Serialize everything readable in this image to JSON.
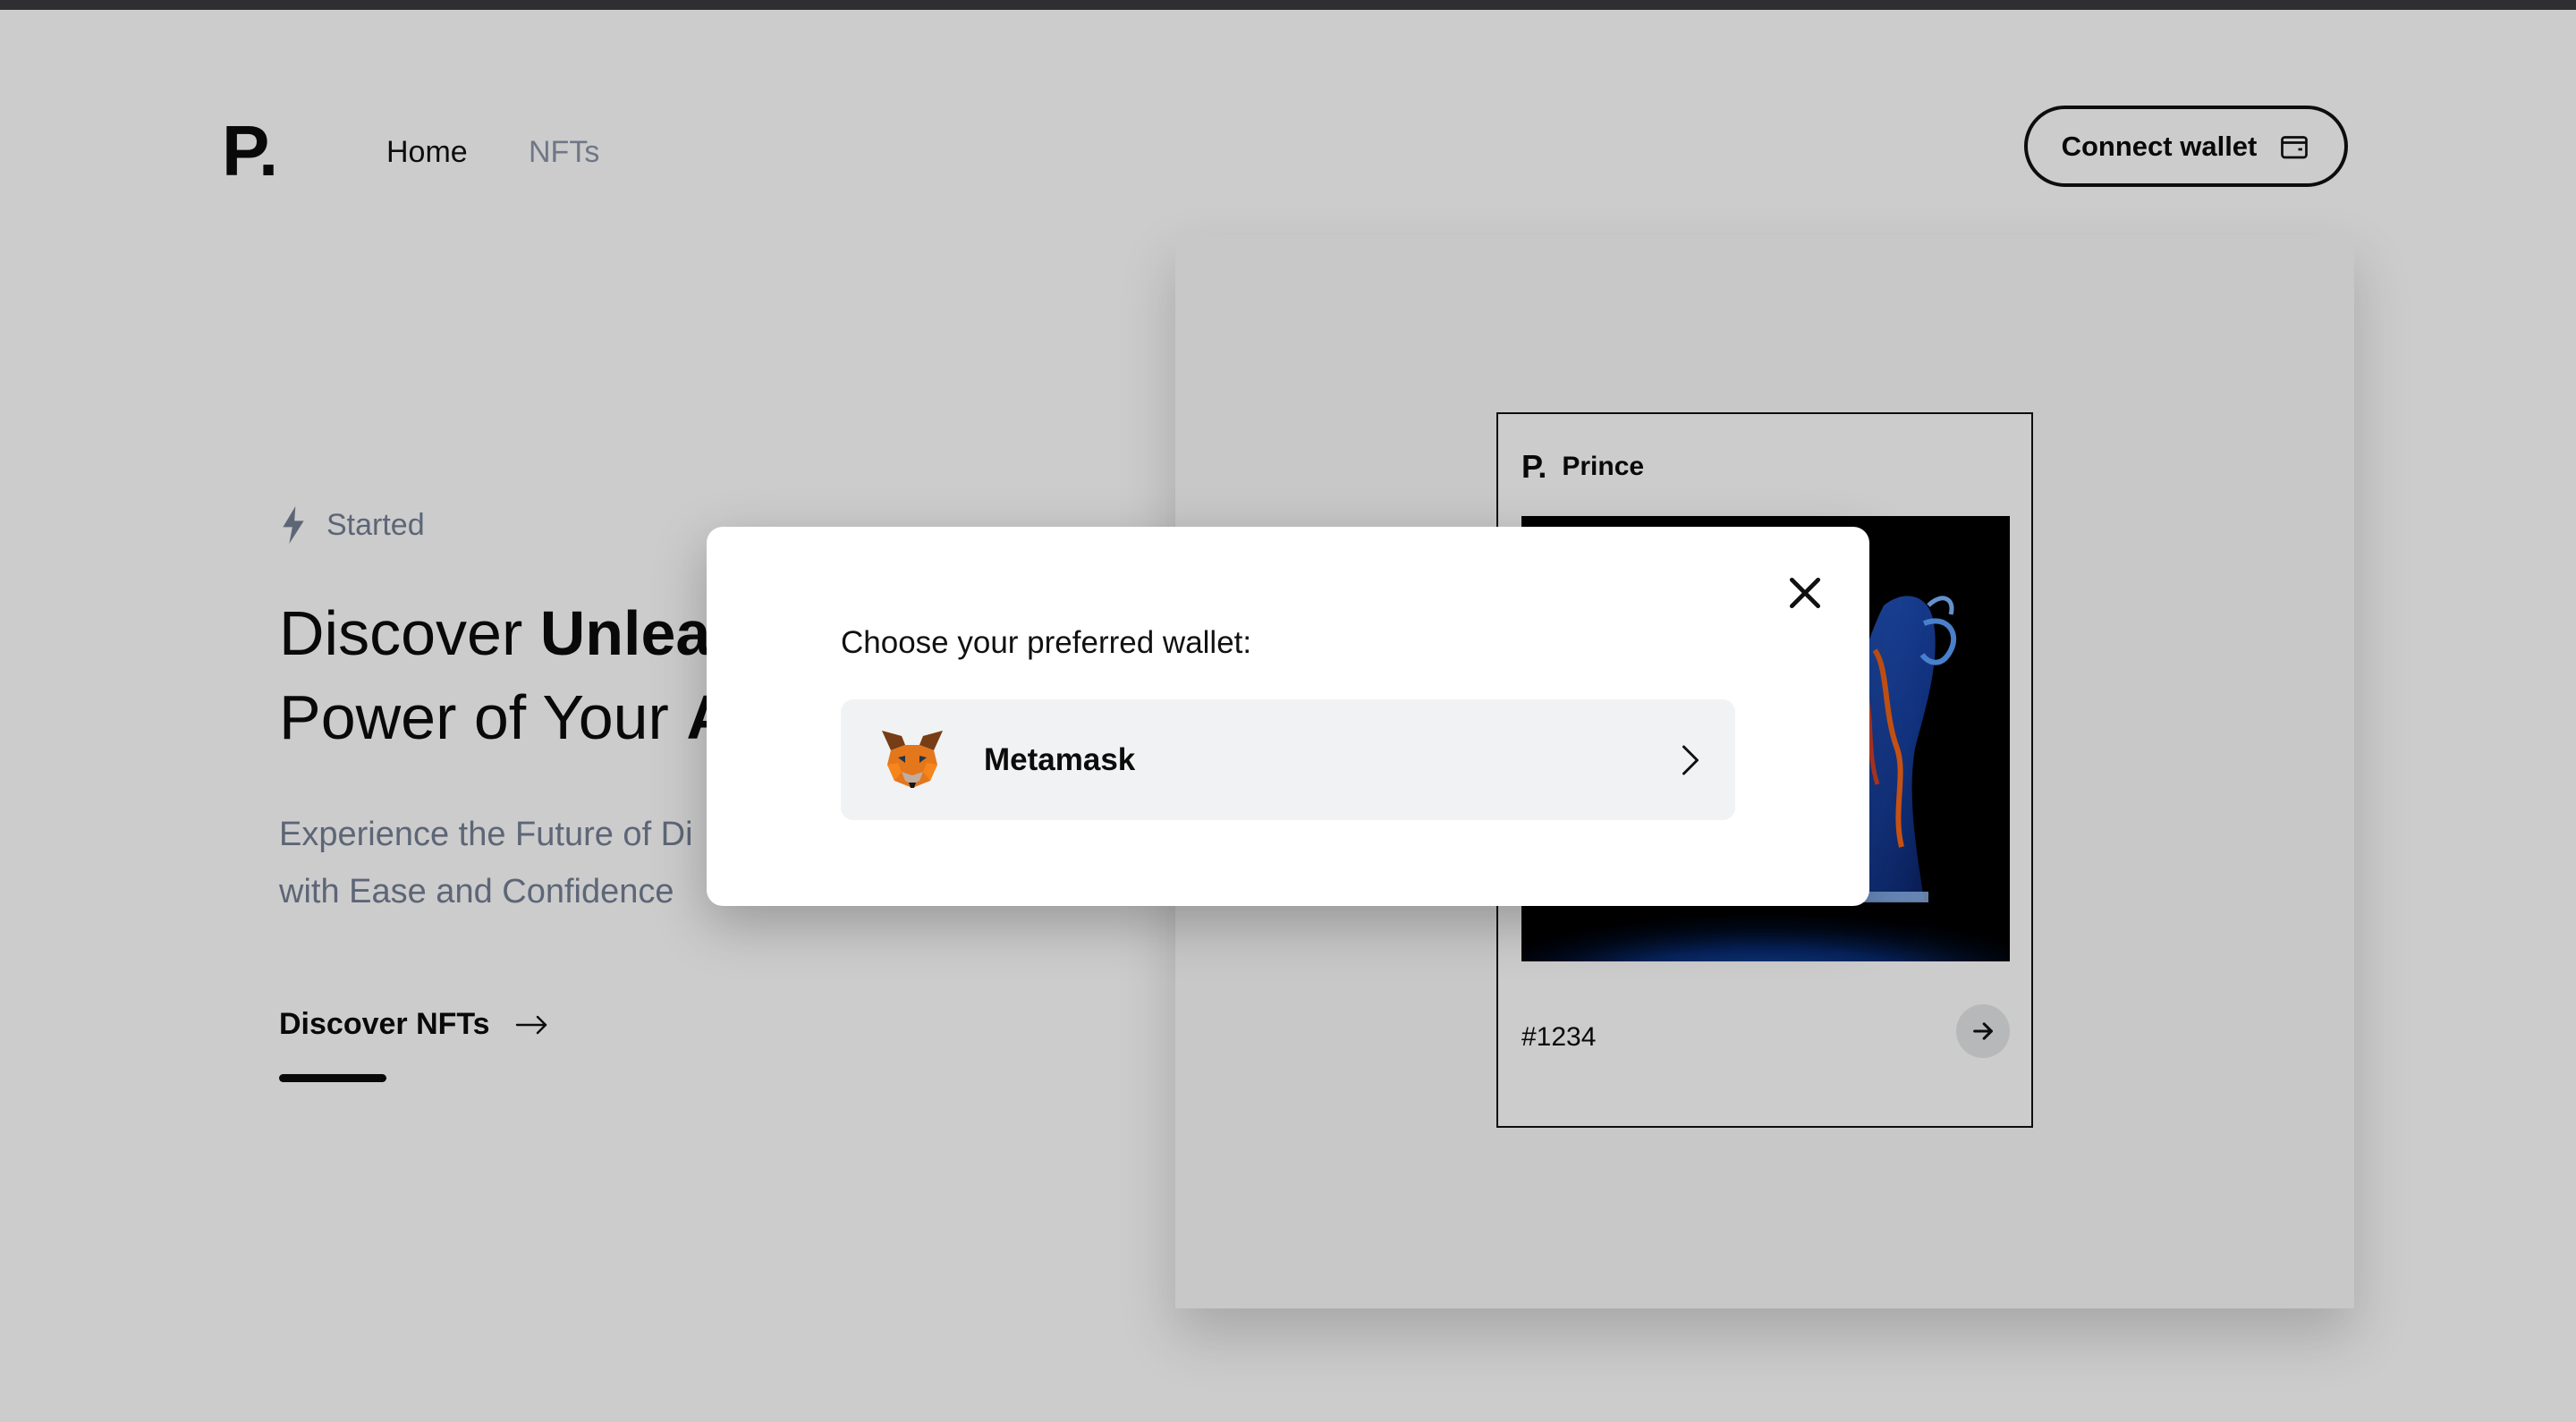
{
  "header": {
    "logo": "P.",
    "nav": [
      {
        "label": "Home",
        "active": true
      },
      {
        "label": "NFTs",
        "active": false
      }
    ],
    "connect_button": {
      "label": "Connect wallet",
      "icon": "wallet-icon"
    }
  },
  "hero": {
    "badge": {
      "icon": "lightning-icon",
      "label": "Started"
    },
    "headline": {
      "line1_regular": "Discover ",
      "line1_bold": "Unlea",
      "line2_regular": "Power of Your ",
      "line2_bold": "A"
    },
    "subtext": {
      "line1": "Experience the Future of Di",
      "line2": "with Ease and Confidence"
    },
    "cta": {
      "label": "Discover NFTs",
      "icon": "arrow-right-icon"
    }
  },
  "nft_card": {
    "logo": "P.",
    "name": "Prince",
    "token_id": "#1234",
    "action_icon": "arrow-right-icon"
  },
  "modal": {
    "title": "Choose your preferred wallet:",
    "close_icon": "close-icon",
    "wallets": [
      {
        "label": "Metamask",
        "icon": "metamask-fox-icon",
        "chevron_icon": "chevron-right-icon"
      }
    ]
  },
  "colors": {
    "text": "#0c0c0c",
    "muted": "#758095",
    "nav_inactive": "#8a96a8",
    "overlay": "rgba(0,0,0,0.2)",
    "wallet_option_bg": "#f1f2f3",
    "metamask_orange": "#e2761b"
  }
}
